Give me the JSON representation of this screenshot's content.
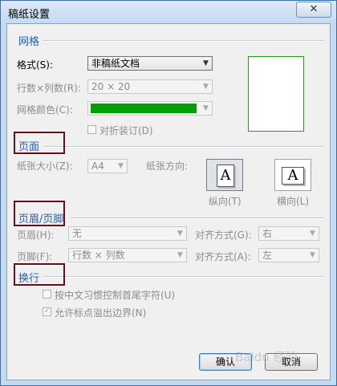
{
  "window": {
    "title": "稿纸设置",
    "close_label": "✕"
  },
  "grid": {
    "title": "网格",
    "format_label": "格式(S):",
    "format_value": "非稿纸文档",
    "rows_cols_label": "行数×列数(R):",
    "rows_cols_value": "20 × 20",
    "color_label": "网格颜色(C):",
    "color_value": "#00a000",
    "fold_label": "对折装订(D)"
  },
  "page": {
    "title": "页面",
    "size_label": "纸张大小(Z):",
    "size_value": "A4",
    "orientation_label": "纸张方向:",
    "portrait_label": "纵向(T)",
    "landscape_label": "横向(L)",
    "glyph": "A"
  },
  "header_footer": {
    "title": "页眉/页脚",
    "header_label": "页眉(H):",
    "header_value": "无",
    "header_align_label": "对齐方式(G):",
    "header_align_value": "右",
    "footer_label": "页脚(F):",
    "footer_value": "行数 × 列数",
    "footer_align_label": "对齐方式(A):",
    "footer_align_value": "左"
  },
  "wrap": {
    "title": "换行",
    "option1_label": "按中文习惯控制首尾字符(U)",
    "option2_label": "允许标点溢出边界(N)",
    "option2_checked": true
  },
  "buttons": {
    "ok_label": "确认",
    "cancel_label": "取消"
  },
  "watermark": "Baidu 经验"
}
